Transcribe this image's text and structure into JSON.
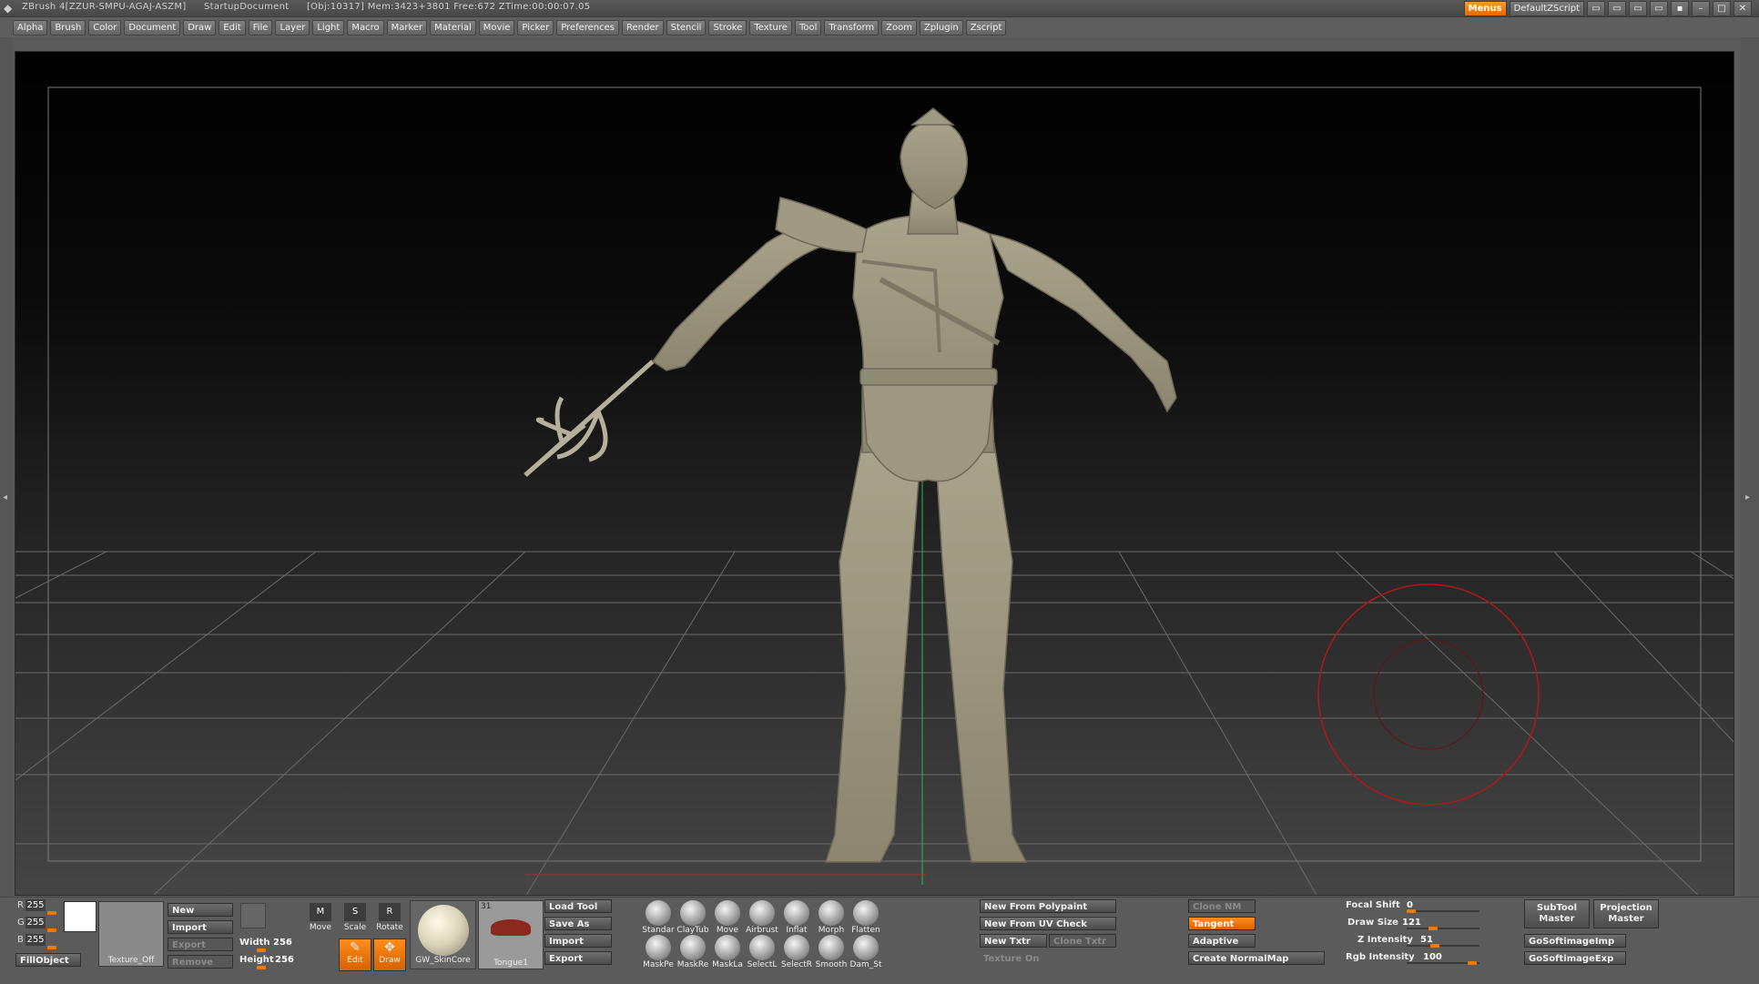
{
  "titlebar": {
    "app": "ZBrush 4[ZZUR-SMPU-AGAJ-ASZM]",
    "document": "StartupDocument",
    "stats": "[Obj:10317] Mem:3423+3801 Free:672 ZTime:00:00:07.05",
    "menus_button": "Menus",
    "script_button": "DefaultZScript"
  },
  "menubar": {
    "items": [
      "Alpha",
      "Brush",
      "Color",
      "Document",
      "Draw",
      "Edit",
      "File",
      "Layer",
      "Light",
      "Macro",
      "Marker",
      "Material",
      "Movie",
      "Picker",
      "Preferences",
      "Render",
      "Stencil",
      "Stroke",
      "Texture",
      "Tool",
      "Transform",
      "Zoom",
      "Zplugin",
      "Zscript"
    ]
  },
  "color": {
    "r_label": "R",
    "r": "255",
    "g_label": "G",
    "g": "255",
    "b_label": "B",
    "b": "255",
    "fill_object": "FillObject",
    "swatch": "#ffffff"
  },
  "texture": {
    "label": "Texture_Off",
    "new": "New",
    "import": "Import",
    "export": "Export",
    "remove": "Remove",
    "width_label": "Width",
    "width": "256",
    "height_label": "Height",
    "height": "256"
  },
  "transform": {
    "move": "Move",
    "scale": "Scale",
    "rotate": "Rotate",
    "edit": "Edit",
    "draw": "Draw"
  },
  "material": {
    "name": "GW_SkinCore"
  },
  "tool": {
    "name": "Tongue1",
    "count": "31",
    "load": "Load Tool",
    "save_as": "Save As",
    "import": "Import",
    "export": "Export"
  },
  "brushes": {
    "row1": [
      "Standar",
      "ClayTub",
      "Move",
      "Airbrust",
      "Inflat",
      "Morph",
      "Flatten"
    ],
    "row2": [
      "MaskPe",
      "MaskRe",
      "MaskLa",
      "SelectL",
      "SelectR",
      "Smooth",
      "Dam_St"
    ]
  },
  "uv": {
    "new_from_polypaint": "New From Polypaint",
    "new_from_uv_check": "New From UV Check",
    "new_txtr": "New Txtr",
    "clone_txtr": "Clone Txtr",
    "texture_on": "Texture On"
  },
  "normalmap": {
    "clone_nm": "Clone NM",
    "tangent": "Tangent",
    "adaptive": "Adaptive",
    "create": "Create NormalMap"
  },
  "sliders": {
    "focal_shift_label": "Focal Shift",
    "focal_shift": "0",
    "draw_size_label": "Draw Size",
    "draw_size": "121",
    "z_intensity_label": "Z Intensity",
    "z_intensity": "51",
    "rgb_intensity_label": "Rgb Intensity",
    "rgb_intensity": "100"
  },
  "plugins": {
    "subtool_master": "SubTool Master",
    "projection_master": "Projection Master",
    "go_softimage_imp": "GoSoftimageImp",
    "go_softimage_exp": "GoSoftimageExp"
  }
}
